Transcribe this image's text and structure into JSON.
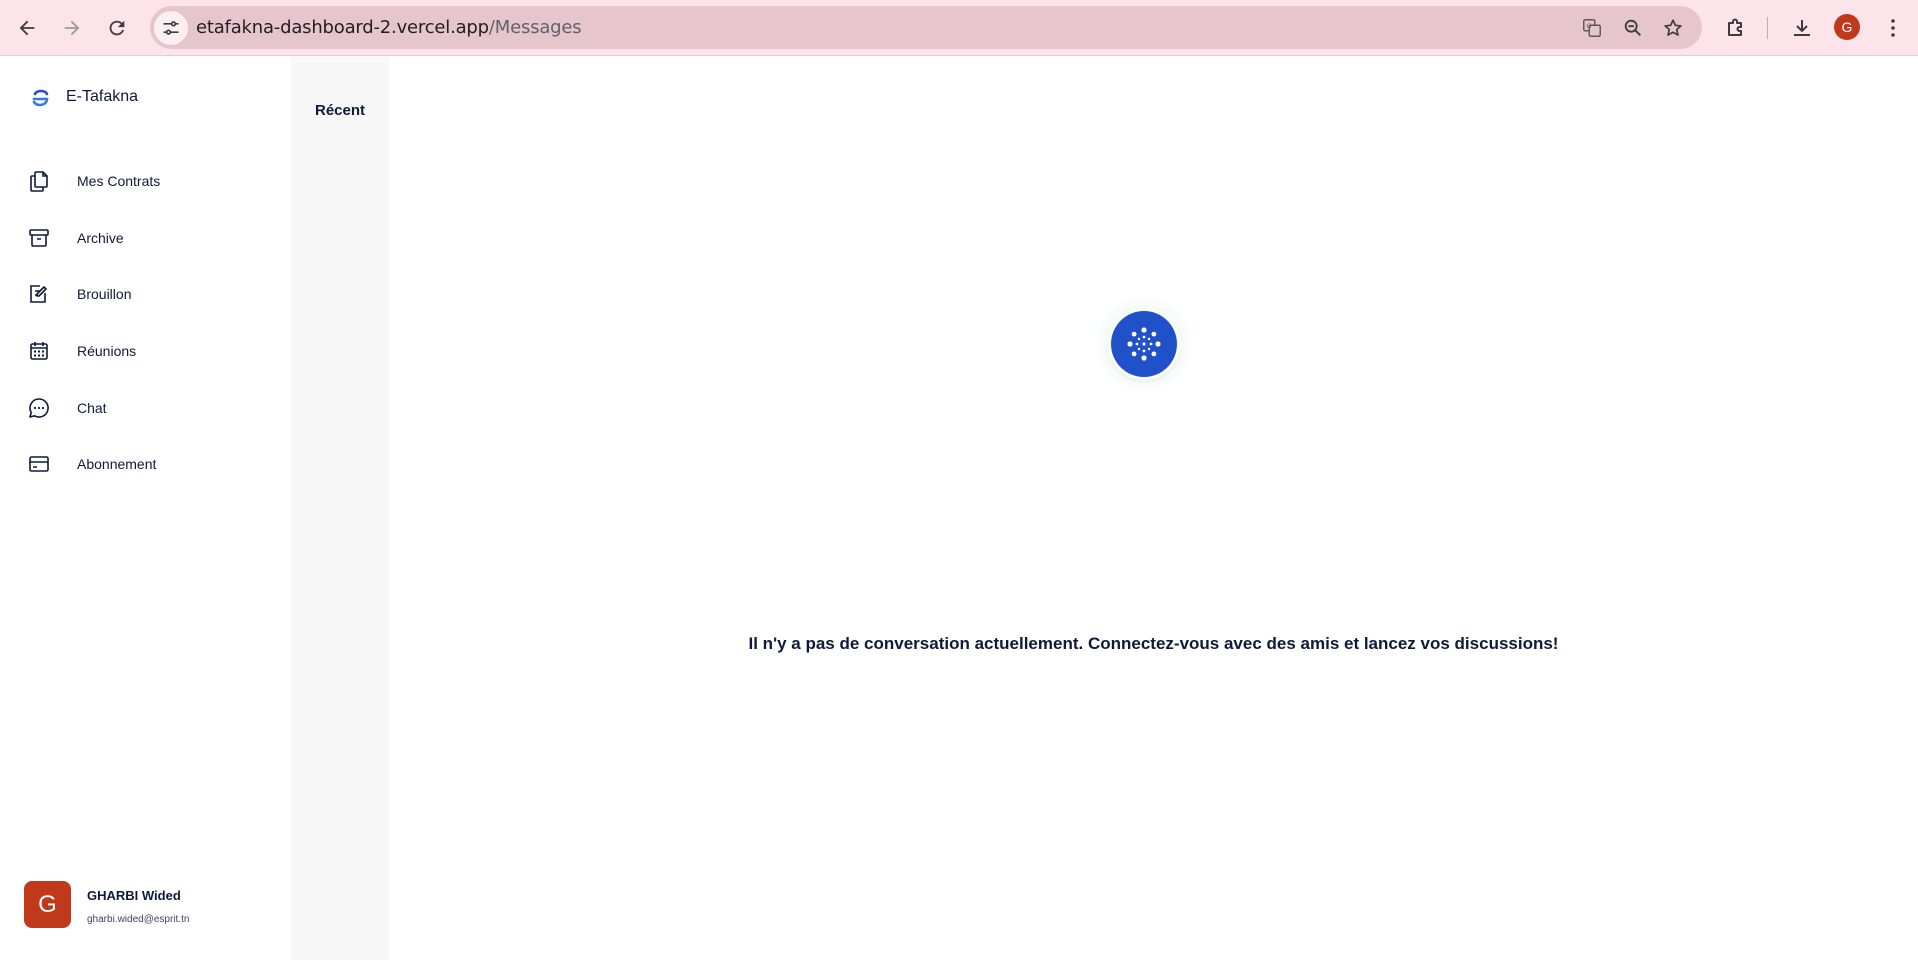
{
  "browser": {
    "url_host": "etafakna-dashboard-2.vercel.app",
    "url_path": "/Messages",
    "profile_initial": "G"
  },
  "sidebar": {
    "brand": "E-Tafakna",
    "items": [
      {
        "label": "Mes Contrats",
        "icon": "contracts-icon"
      },
      {
        "label": "Archive",
        "icon": "archive-icon"
      },
      {
        "label": "Brouillon",
        "icon": "draft-icon"
      },
      {
        "label": "Réunions",
        "icon": "calendar-icon"
      },
      {
        "label": "Chat",
        "icon": "chat-icon"
      },
      {
        "label": "Abonnement",
        "icon": "credit-card-icon"
      }
    ],
    "user": {
      "initial": "G",
      "name": "GHARBI Wided",
      "email": "gharbi.wided@esprit.tn"
    }
  },
  "conversations": {
    "title": "Récent"
  },
  "main": {
    "empty_message": "Il n'y a pas de conversation actuellement. Connectez-vous avec des amis et lancez vos discussions!"
  },
  "colors": {
    "accent": "#2151c9",
    "avatar": "#c0391b",
    "browser_bar": "#fce4ea",
    "text": "#0f1a3a"
  }
}
